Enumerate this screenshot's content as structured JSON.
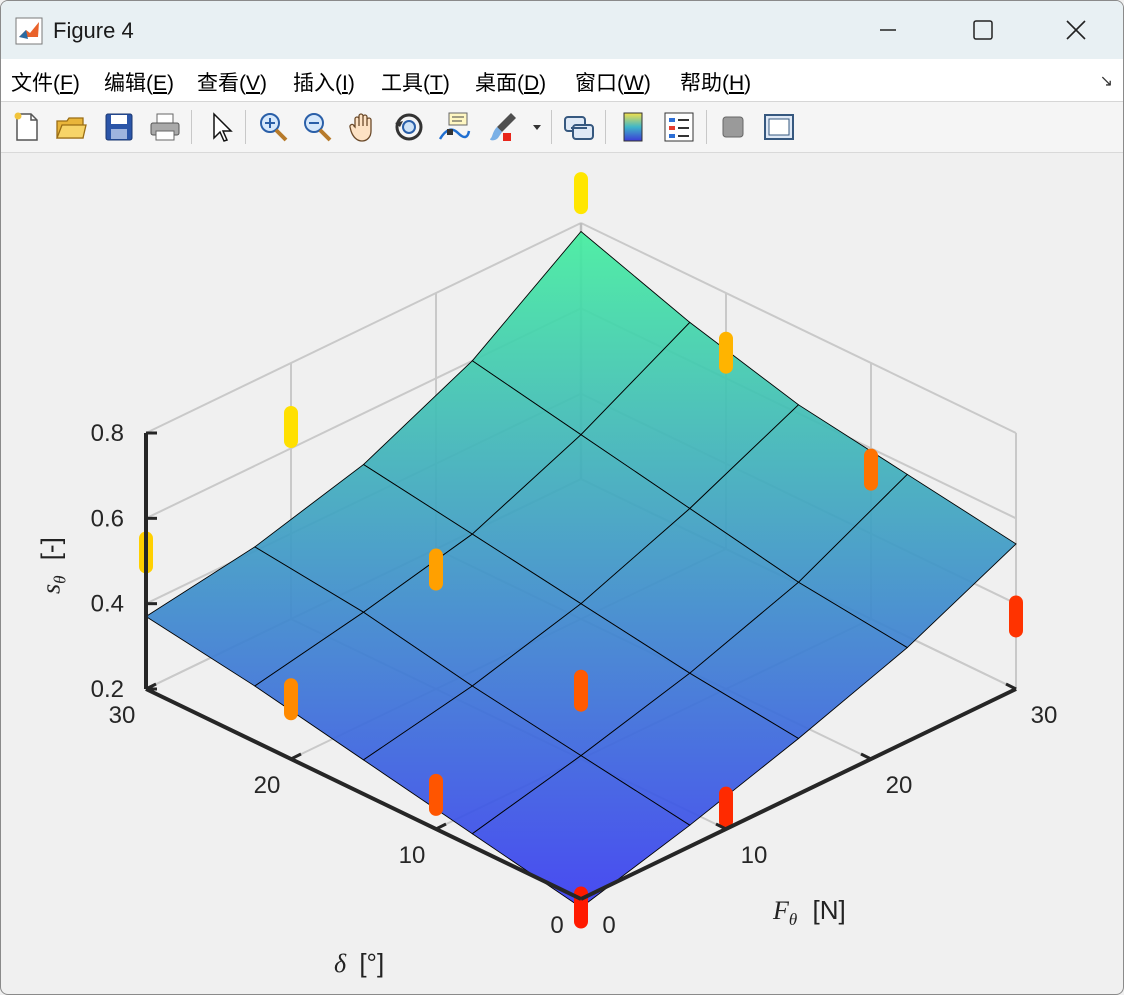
{
  "window": {
    "title": "Figure 4"
  },
  "menu": [
    {
      "pre": "文件(",
      "key": "F",
      "post": ")"
    },
    {
      "pre": "编辑(",
      "key": "E",
      "post": ")"
    },
    {
      "pre": "查看(",
      "key": "V",
      "post": ")"
    },
    {
      "pre": "插入(",
      "key": "I",
      "post": ")"
    },
    {
      "pre": "工具(",
      "key": "T",
      "post": ")"
    },
    {
      "pre": "桌面(",
      "key": "D",
      "post": ")"
    },
    {
      "pre": "窗口(",
      "key": "W",
      "post": ")"
    },
    {
      "pre": "帮助(",
      "key": "H",
      "post": ")"
    }
  ],
  "toolbar": [
    "new-figure-icon",
    "open-file-icon",
    "save-icon",
    "print-icon",
    "select-arrow-icon",
    "zoom-in-icon",
    "zoom-out-icon",
    "pan-hand-icon",
    "rotate-3d-icon",
    "data-cursor-icon",
    "brush-icon",
    "link-plot-icon",
    "colorbar-icon",
    "legend-icon",
    "hide-plot-tools-icon",
    "show-plot-tools-icon"
  ],
  "chart_data": {
    "type": "surface",
    "colormap": "blue-to-green (surface), red-orange-yellow (markers)",
    "xlabel": "F",
    "xlabel_sub": "θ",
    "xlabel_unit": "[N]",
    "ylabel": "δ",
    "ylabel_unit": "[°]",
    "zlabel": "s",
    "zlabel_sub": "θ",
    "zlabel_unit": "[-]",
    "x_ticks": [
      "0",
      "10",
      "20",
      "30"
    ],
    "y_ticks": [
      "0",
      "10",
      "20",
      "30"
    ],
    "z_ticks": [
      "0.2",
      "0.4",
      "0.6",
      "0.8"
    ],
    "xlim": [
      0,
      30
    ],
    "ylim": [
      0,
      30
    ],
    "zlim": [
      0.2,
      0.8
    ],
    "grid": true,
    "surface_grid": {
      "F": [
        0,
        7.5,
        15,
        22.5,
        30
      ],
      "delta": [
        0,
        7.5,
        15,
        22.5,
        30
      ],
      "z": [
        [
          0.18,
          0.25,
          0.33,
          0.42,
          0.54
        ],
        [
          0.23,
          0.29,
          0.36,
          0.45,
          0.58
        ],
        [
          0.28,
          0.33,
          0.4,
          0.5,
          0.62
        ],
        [
          0.33,
          0.38,
          0.44,
          0.55,
          0.69
        ],
        [
          0.37,
          0.41,
          0.48,
          0.6,
          0.78
        ]
      ]
    },
    "points": [
      {
        "F": 0,
        "delta": 0,
        "z": 0.18,
        "color": "#ff1a00"
      },
      {
        "F": 10,
        "delta": 0,
        "z": 0.25,
        "color": "#ff2a00"
      },
      {
        "F": 30,
        "delta": 0,
        "z": 0.37,
        "color": "#ff3300"
      },
      {
        "F": 0,
        "delta": 10,
        "z": 0.28,
        "color": "#ff5500"
      },
      {
        "F": 10,
        "delta": 10,
        "z": 0.36,
        "color": "#ff5a00"
      },
      {
        "F": 30,
        "delta": 10,
        "z": 0.55,
        "color": "#ff7200"
      },
      {
        "F": 0,
        "delta": 20,
        "z": 0.34,
        "color": "#ff8a00"
      },
      {
        "F": 10,
        "delta": 20,
        "z": 0.48,
        "color": "#ffa000"
      },
      {
        "F": 30,
        "delta": 20,
        "z": 0.66,
        "color": "#ffb400"
      },
      {
        "F": 0,
        "delta": 30,
        "z": 0.52,
        "color": "#ffd000"
      },
      {
        "F": 10,
        "delta": 30,
        "z": 0.65,
        "color": "#ffe000"
      },
      {
        "F": 30,
        "delta": 30,
        "z": 0.87,
        "color": "#ffe600"
      }
    ]
  }
}
